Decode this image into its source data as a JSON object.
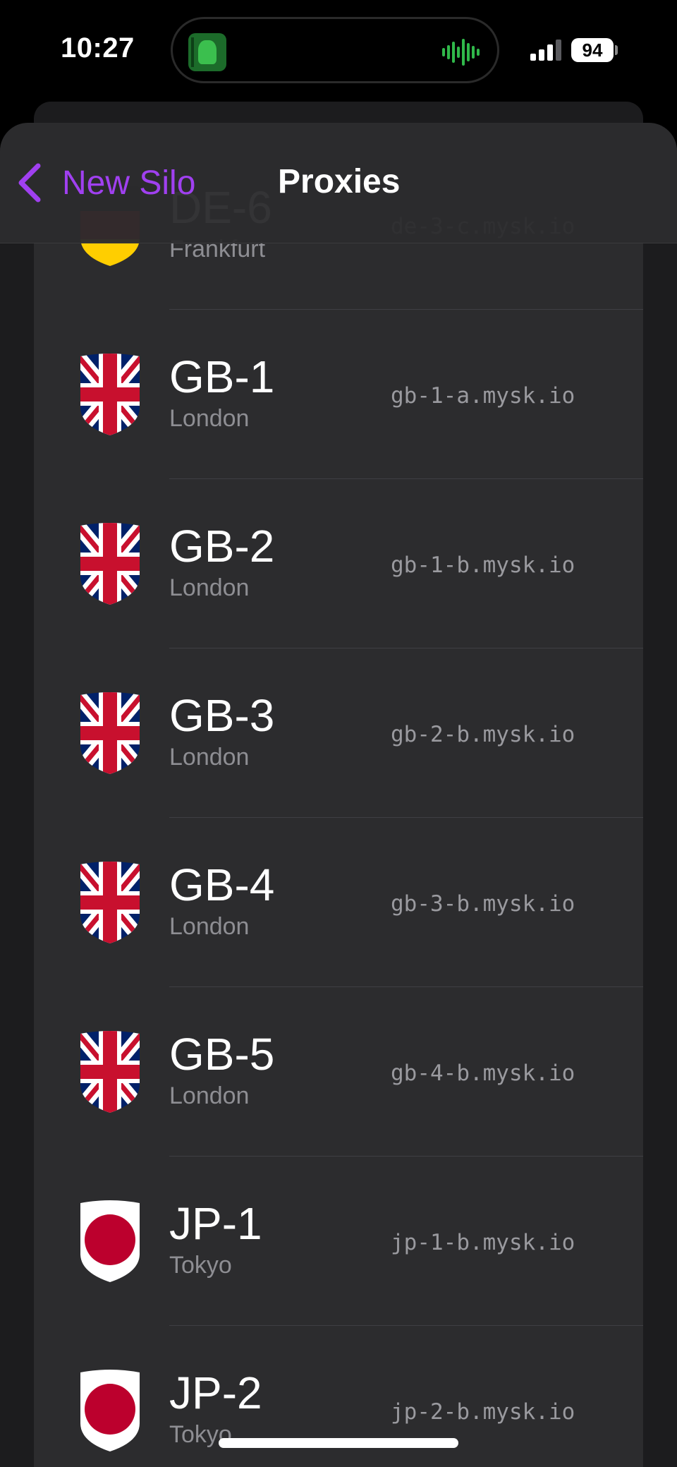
{
  "status_bar": {
    "time": "10:27",
    "battery": "94",
    "now_playing_icon": "album-art-icon",
    "waveform_icon": "waveform-icon",
    "signal_icon": "cellular-signal-icon",
    "accent_green": "#30b84a"
  },
  "nav": {
    "back_label": "New Silo",
    "title": "Proxies",
    "accent_color": "#a040f0"
  },
  "proxies": [
    {
      "code": "DE-6",
      "city": "Frankfurt",
      "host": "de-3-c.mysk.io",
      "flag": "de"
    },
    {
      "code": "GB-1",
      "city": "London",
      "host": "gb-1-a.mysk.io",
      "flag": "gb"
    },
    {
      "code": "GB-2",
      "city": "London",
      "host": "gb-1-b.mysk.io",
      "flag": "gb"
    },
    {
      "code": "GB-3",
      "city": "London",
      "host": "gb-2-b.mysk.io",
      "flag": "gb"
    },
    {
      "code": "GB-4",
      "city": "London",
      "host": "gb-3-b.mysk.io",
      "flag": "gb"
    },
    {
      "code": "GB-5",
      "city": "London",
      "host": "gb-4-b.mysk.io",
      "flag": "gb"
    },
    {
      "code": "JP-1",
      "city": "Tokyo",
      "host": "jp-1-b.mysk.io",
      "flag": "jp"
    },
    {
      "code": "JP-2",
      "city": "Tokyo",
      "host": "jp-2-b.mysk.io",
      "flag": "jp"
    }
  ]
}
